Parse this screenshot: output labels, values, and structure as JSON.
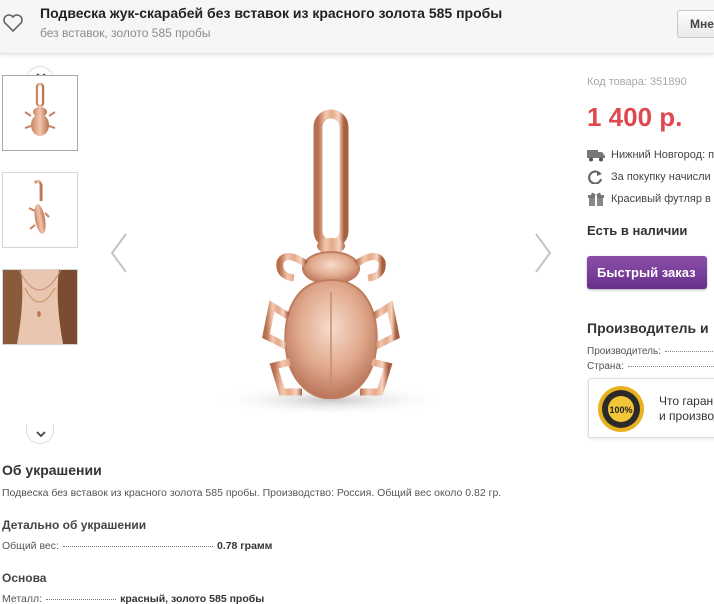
{
  "header": {
    "title": "Подвеска жук-скарабей без вставок из красного золота 585 пробы",
    "subtitle": "без вставок, золото 585 пробы",
    "more_label": "Мне"
  },
  "icons": {
    "favorite": "heart-icon",
    "delivery": "truck-icon",
    "bonus": "refresh-icon",
    "gift": "gift-icon",
    "prev": "chevron-left-icon",
    "next": "chevron-right-icon"
  },
  "colors": {
    "price": "#e0484f",
    "quick_order": "#7a3d99",
    "gold": "#e3a98a"
  },
  "product": {
    "code": "Код товара: 351890",
    "price": "1 400 р.",
    "features": [
      "Нижний Новгород: п",
      "За покупку начисли",
      "Красивый футляр в"
    ],
    "stock": "Есть в наличии",
    "quick_order": "Быстрый заказ"
  },
  "maker": {
    "heading": "Производитель и",
    "rows": [
      "Производитель:",
      "Страна:"
    ],
    "guarantee_line1": "Что гаран",
    "guarantee_line2": "и производ",
    "seal_text": "100%"
  },
  "about": {
    "heading": "Об украшении",
    "text": "Подвеска без вставок из красного золота 585 пробы. Производство: Россия. Общий вес около 0.82 гр.",
    "details_heading": "Детально об украшении",
    "weight_label": "Общий вес:",
    "weight_value": "0.78 грамм",
    "base_heading": "Основа",
    "metal_label": "Металл:",
    "metal_value": "красный, золото 585 пробы"
  }
}
